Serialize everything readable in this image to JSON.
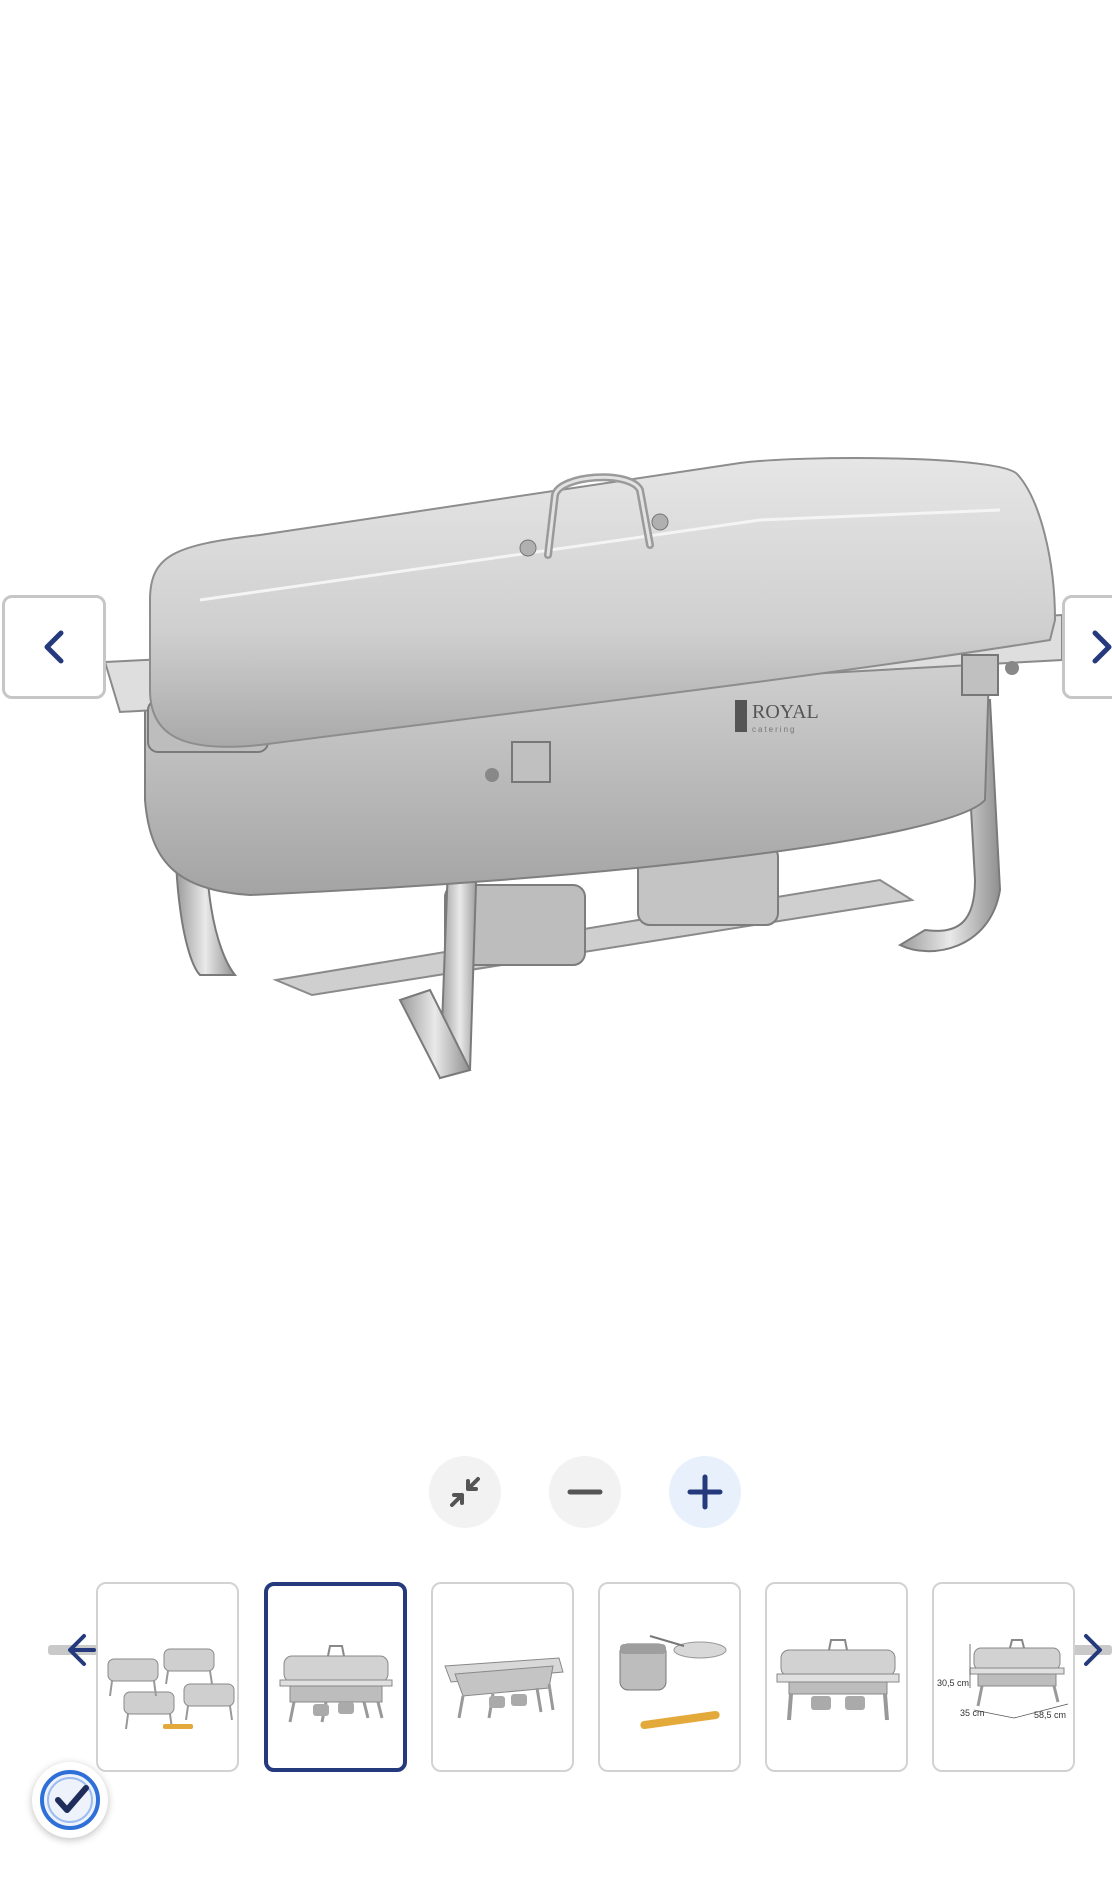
{
  "gallery": {
    "logo_text": "ROYAL",
    "logo_subtext": "catering",
    "active_index": 1,
    "colors": {
      "accent": "#253a7c",
      "border": "#c6c6c6",
      "steel": "#c8c8c8"
    }
  },
  "navigation": {
    "prev_icon": "chevron-left-icon",
    "next_icon": "chevron-right-icon"
  },
  "zoom": {
    "fit_icon": "collapse-arrows-icon",
    "out_icon": "minus-icon",
    "in_icon": "plus-icon"
  },
  "thumbnails": {
    "items": [
      {
        "name": "four-chafers-set"
      },
      {
        "name": "chafer-closed"
      },
      {
        "name": "chafer-open-pan"
      },
      {
        "name": "fuel-holder-accessories"
      },
      {
        "name": "chafer-front-view"
      },
      {
        "name": "chafer-dimensions"
      }
    ],
    "dimensions": {
      "height": "30,5 cm",
      "depth": "35 cm",
      "width": "58,5 cm"
    }
  },
  "badge": {
    "icon": "verified-check-icon"
  }
}
